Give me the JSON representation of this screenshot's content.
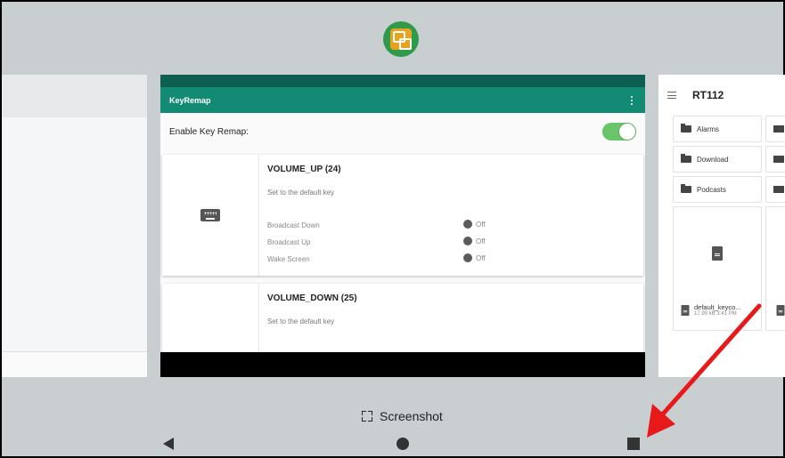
{
  "center_app": {
    "title": "KeyRemap",
    "enable_label": "Enable Key Remap:",
    "enable_state": true,
    "cards": [
      {
        "title": "VOLUME_UP (24)",
        "subtitle": "Set to the default key",
        "options": [
          {
            "label": "Broadcast Down",
            "state": "Off"
          },
          {
            "label": "Broadcast Up",
            "state": "Off"
          },
          {
            "label": "Wake Screen",
            "state": "Off"
          }
        ]
      },
      {
        "title": "VOLUME_DOWN (25)",
        "subtitle": "Set to the default key"
      }
    ]
  },
  "right_app": {
    "title": "RT112",
    "folders": [
      "Alarms",
      "Download",
      "Podcasts"
    ],
    "file": {
      "name": "default_keyco...",
      "meta": "17.99 kB 3:41 PM"
    }
  },
  "system": {
    "screenshot_label": "Screenshot"
  },
  "colors": {
    "app_bar": "#138a74",
    "status_strip": "#0d5f4f",
    "toggle_on": "#6ac46a",
    "annotation_arrow": "#e8191b",
    "background": "#c9ced1"
  },
  "icons": {
    "app_switcher_icon": "app-icon",
    "nav": [
      "back-icon",
      "home-icon",
      "recents-icon"
    ]
  }
}
